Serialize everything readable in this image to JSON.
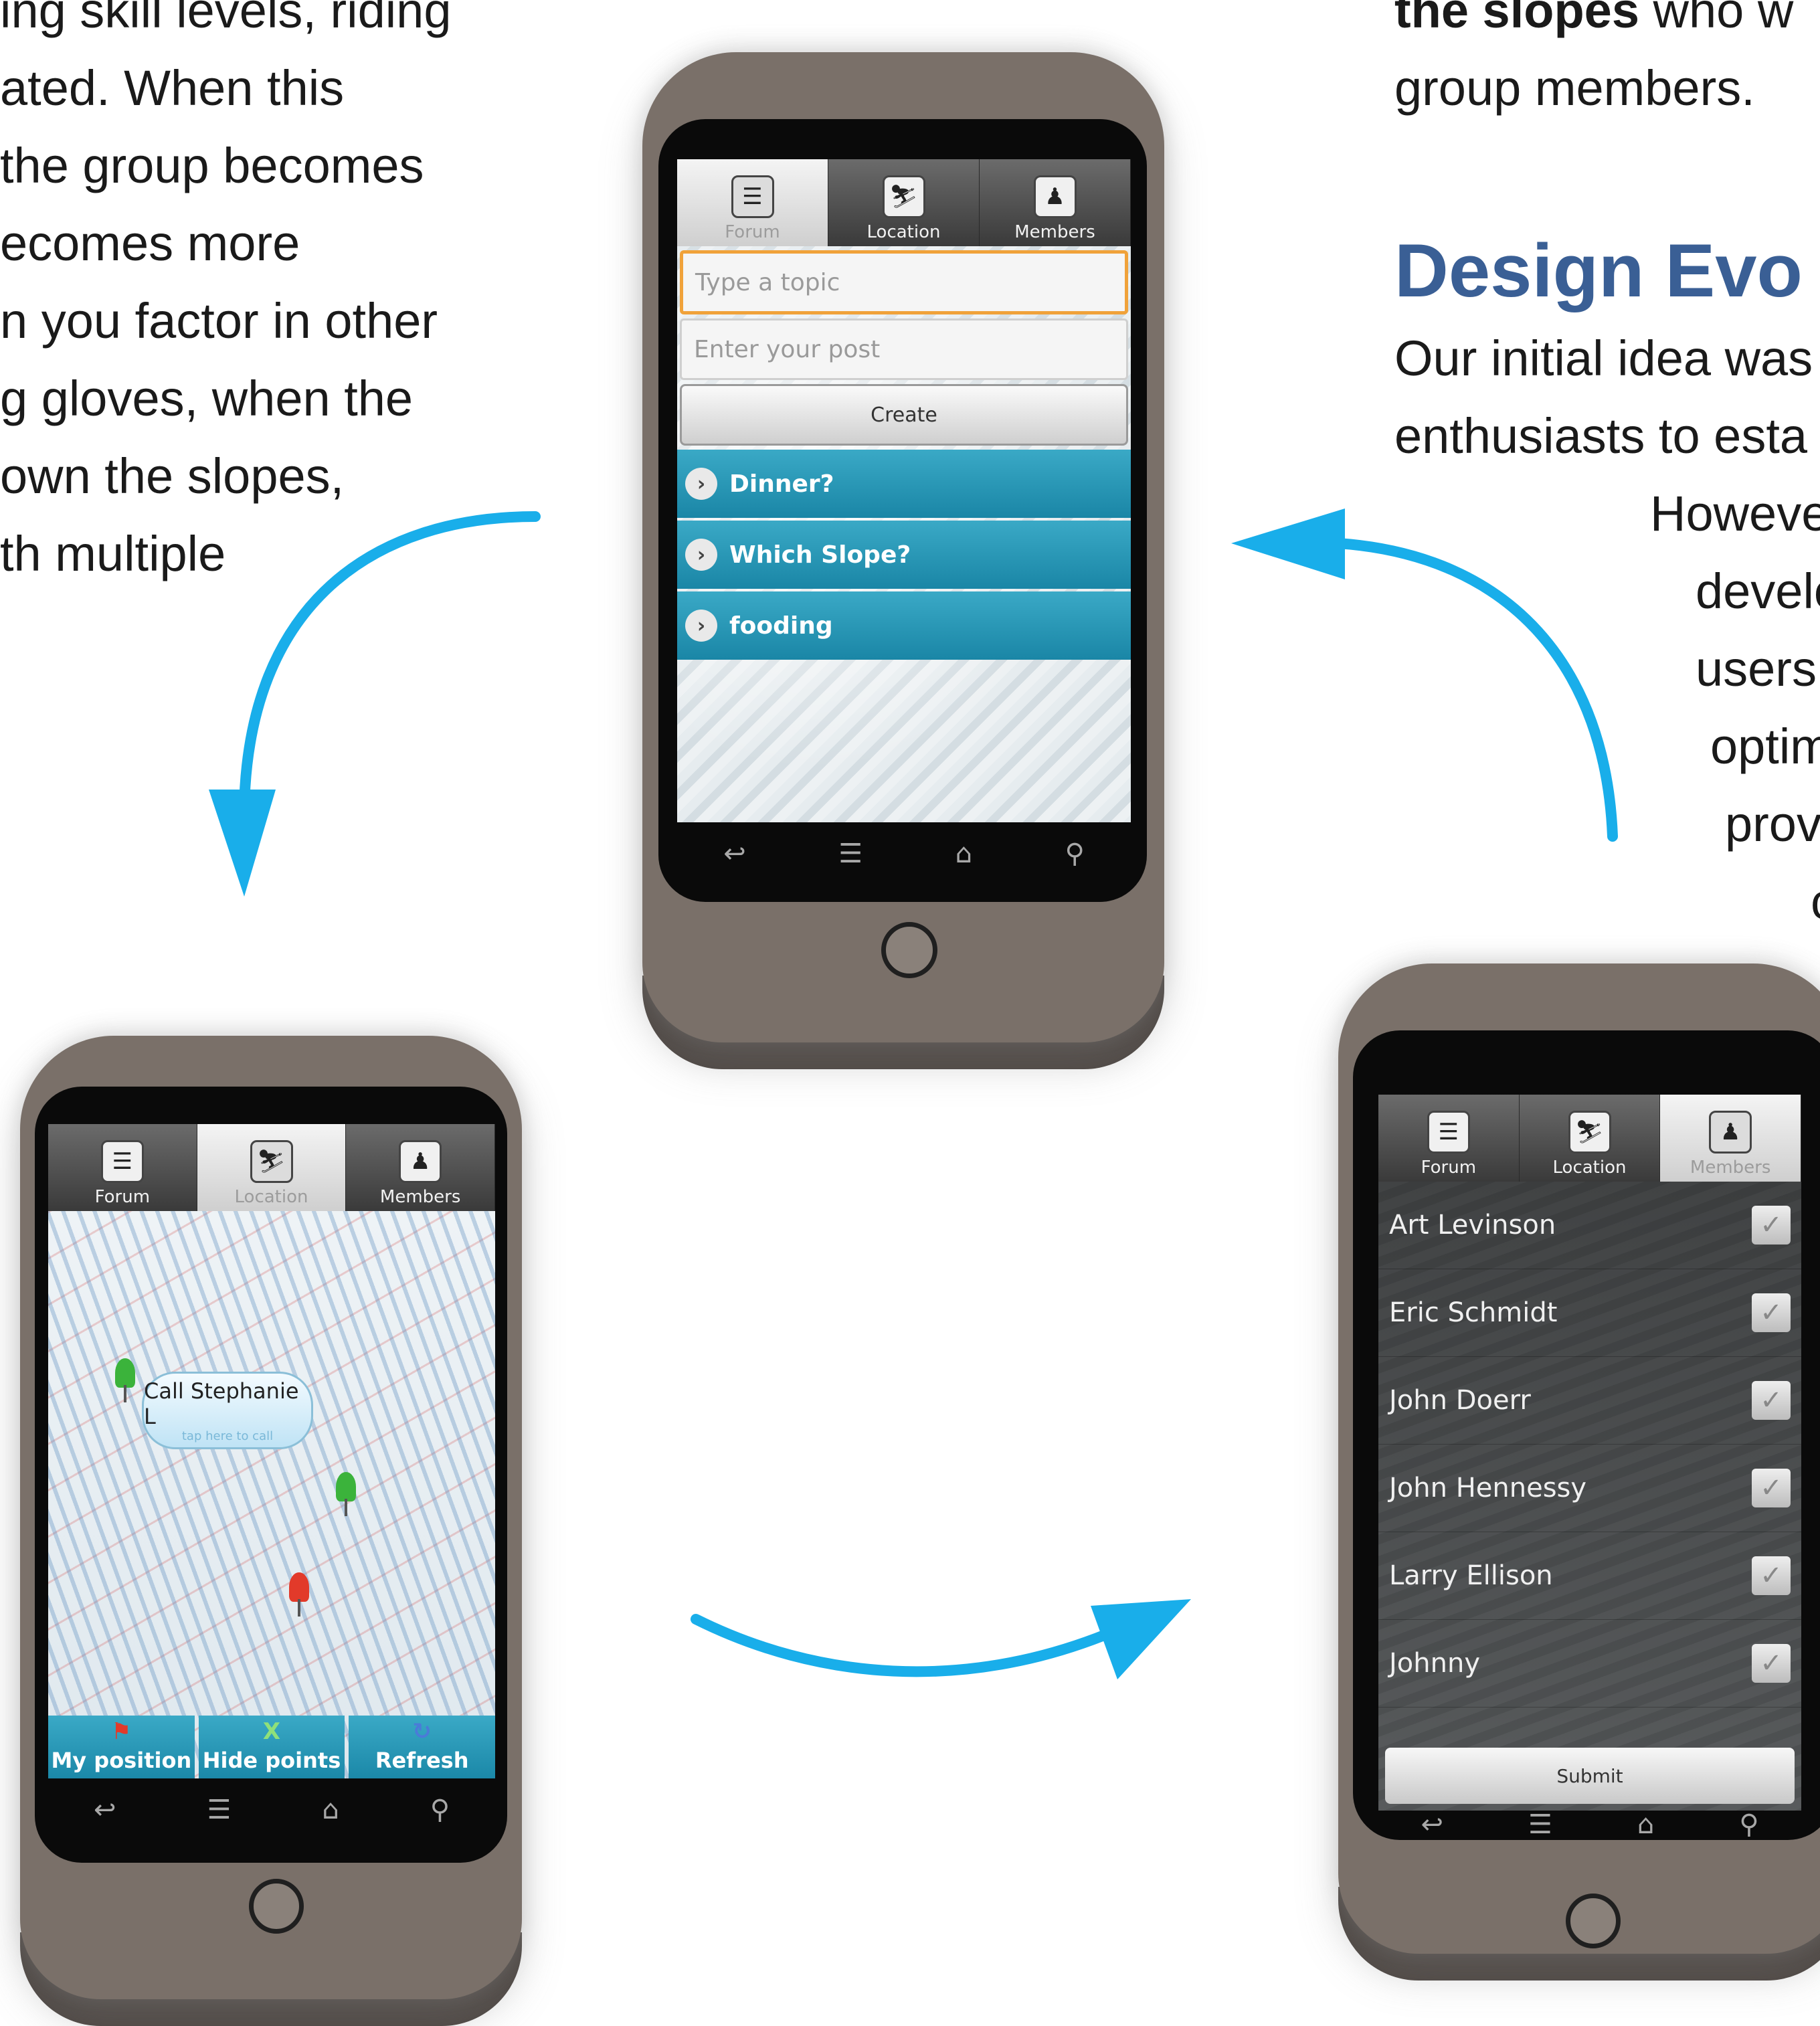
{
  "left_text": {
    "lines": [
      "ing skill levels, riding",
      "ated. When this",
      " the group becomes",
      "ecomes more",
      "n you factor in other",
      "g gloves, when the",
      "own the slopes,",
      "th multiple"
    ]
  },
  "right_text": {
    "top_bold": "the slopes",
    "top_rest": " who w",
    "top_line2": "group members.",
    "heading": "Design Evo",
    "lines": [
      "Our initial idea was",
      "enthusiasts to esta",
      "Howeve",
      "develo",
      "users",
      "optim",
      "prov",
      "c"
    ]
  },
  "tabs": {
    "forum": "Forum",
    "location": "Location",
    "members": "Members"
  },
  "icons": {
    "forum": "speech-bubble-icon",
    "location": "skier-icon",
    "members": "people-icon",
    "back": "back-arrow-icon",
    "menu": "menu-icon",
    "home": "home-icon",
    "search": "search-icon"
  },
  "forum": {
    "topic_placeholder": "Type a topic",
    "post_placeholder": "Enter your post",
    "create_label": "Create",
    "topics": [
      "Dinner?",
      "Which Slope?",
      "fooding"
    ]
  },
  "map": {
    "callout_title": "Call Stephanie L",
    "callout_sub": "tap here to call",
    "buttons": [
      "My position",
      "Hide points",
      "Refresh"
    ]
  },
  "members": {
    "names": [
      "Art   Levinson",
      "Eric Schmidt",
      "John Doerr",
      "John Hennessy",
      "Larry Ellison",
      "Johnny"
    ],
    "submit_label": "Submit"
  },
  "colors": {
    "arrow": "#19aeea",
    "heading": "#3a5f95",
    "topic_bar": "#1a86a6",
    "phone_body": "#7a7069"
  }
}
